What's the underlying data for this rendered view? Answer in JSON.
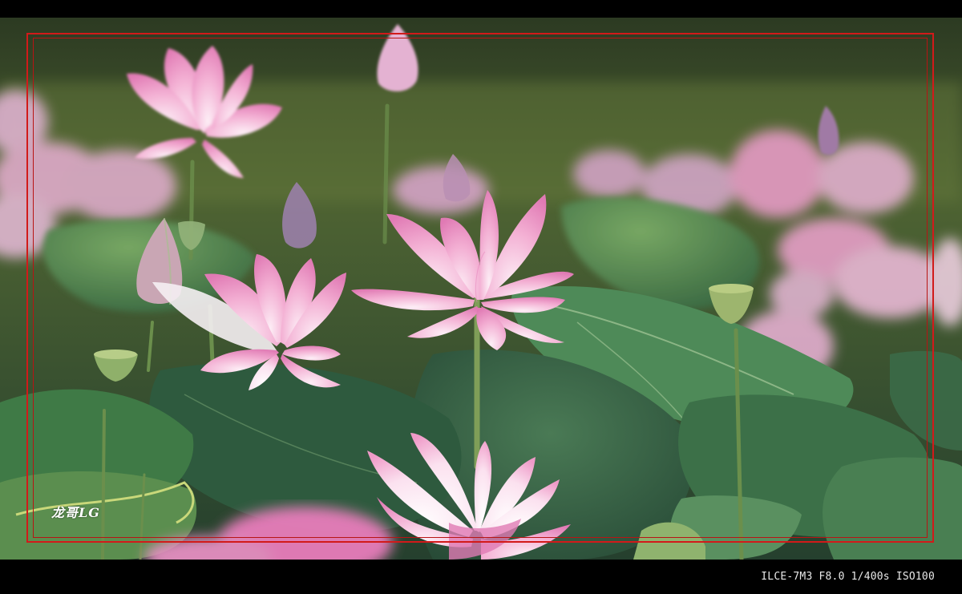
{
  "watermark": {
    "signature": "龙哥LG"
  },
  "exif": {
    "text": "ILCE-7M3 F8.0 1/400s ISO100"
  },
  "colors": {
    "frame": "#d21a1a",
    "background": "#000000",
    "lotus_pink": "#f1a6cf",
    "leaf_green": "#3f7a46"
  }
}
